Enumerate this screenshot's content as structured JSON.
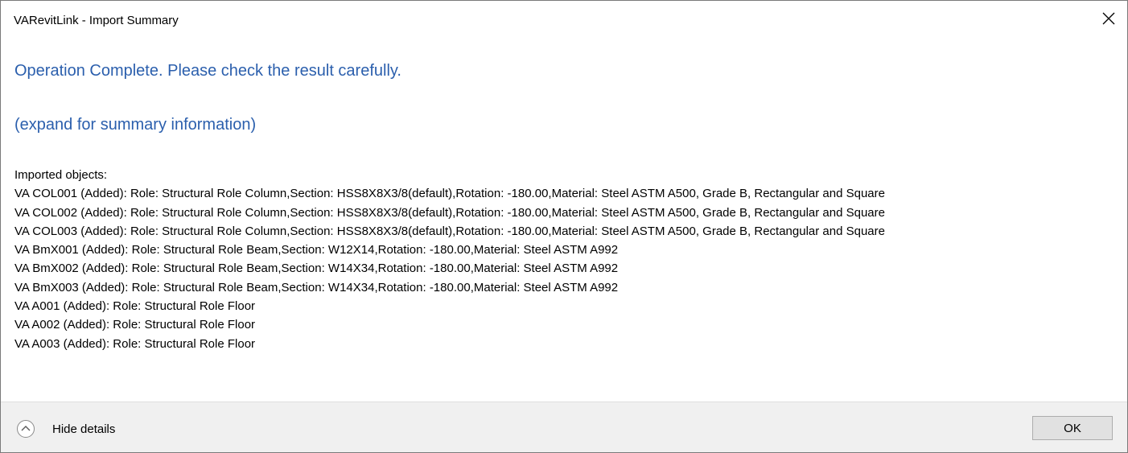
{
  "window": {
    "title": "VARevitLink  - Import Summary"
  },
  "main": {
    "heading": "Operation Complete. Please check the result carefully.",
    "expand_text": "(expand for summary information)",
    "details_header": "Imported objects:",
    "details_lines": [
      "VA COL001 (Added): Role: Structural Role Column,Section: HSS8X8X3/8(default),Rotation: -180.00,Material: Steel ASTM A500, Grade B, Rectangular and Square",
      "VA COL002 (Added): Role: Structural Role Column,Section: HSS8X8X3/8(default),Rotation: -180.00,Material: Steel ASTM A500, Grade B, Rectangular and Square",
      "VA COL003 (Added): Role: Structural Role Column,Section: HSS8X8X3/8(default),Rotation: -180.00,Material: Steel ASTM A500, Grade B, Rectangular and Square",
      "VA BmX001 (Added): Role: Structural Role Beam,Section: W12X14,Rotation: -180.00,Material: Steel ASTM A992",
      "VA BmX002 (Added): Role: Structural Role Beam,Section: W14X34,Rotation: -180.00,Material: Steel ASTM A992",
      "VA BmX003 (Added): Role: Structural Role Beam,Section: W14X34,Rotation: -180.00,Material: Steel ASTM A992",
      "VA A001 (Added): Role: Structural Role Floor",
      "VA A002 (Added): Role: Structural Role Floor",
      "VA A003 (Added): Role: Structural Role Floor"
    ]
  },
  "footer": {
    "toggle_label": "Hide details",
    "ok_label": "OK"
  },
  "icons": {
    "close": "close-icon",
    "collapse": "chevron-up-icon"
  },
  "colors": {
    "heading": "#2b5fad",
    "footer_bg": "#f0f0f0",
    "button_bg": "#e1e1e1"
  }
}
